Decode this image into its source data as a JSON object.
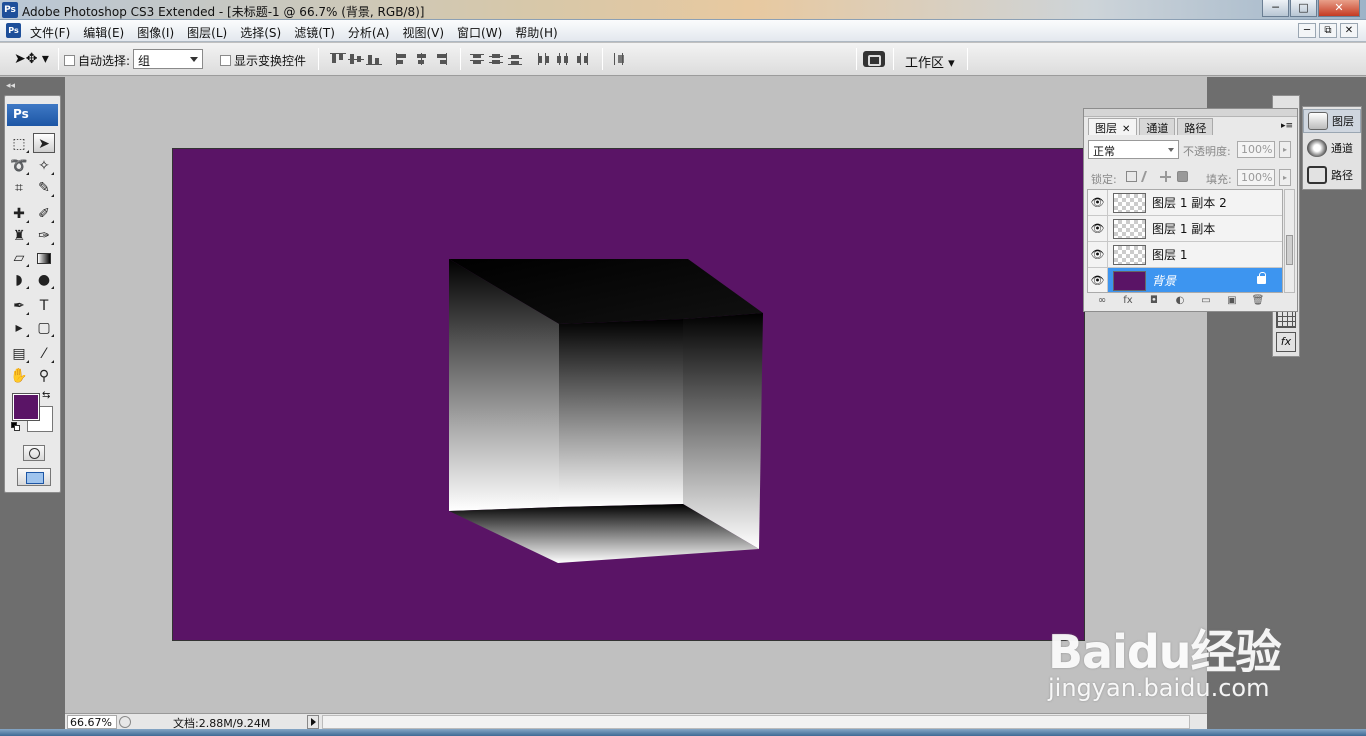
{
  "app": {
    "title": "Adobe Photoshop CS3 Extended - [未标题-1 @ 66.7% (背景, RGB/8)]",
    "logo": "Ps"
  },
  "window_controls": [
    "─",
    "□",
    "✕"
  ],
  "doc_controls": [
    "─",
    "⧉",
    "✕"
  ],
  "menu": [
    "文件(F)",
    "编辑(E)",
    "图像(I)",
    "图层(L)",
    "选择(S)",
    "滤镜(T)",
    "分析(A)",
    "视图(V)",
    "窗口(W)",
    "帮助(H)"
  ],
  "options": {
    "auto_select_label": "自动选择:",
    "auto_select_value": "组",
    "show_transform_label": "显示变换控件",
    "workspace_label": "工作区 ▾"
  },
  "toolbox": {
    "header": "Ps",
    "foreground_color": "#5a1466",
    "background_color": "#ffffff"
  },
  "document": {
    "background_color": "#5a1466",
    "zoom": "66.67%",
    "doc_info": "文档:2.88M/9.24M"
  },
  "layers_panel": {
    "tabs": [
      "图层",
      "通道",
      "路径"
    ],
    "blend_mode": "正常",
    "opacity_label": "不透明度:",
    "opacity_value": "100%",
    "lock_label": "锁定:",
    "fill_label": "填充:",
    "fill_value": "100%",
    "layers": [
      {
        "name": "图层 1 副本 2",
        "selected": false
      },
      {
        "name": "图层 1 副本",
        "selected": false
      },
      {
        "name": "图层 1",
        "selected": false
      },
      {
        "name": "背景",
        "selected": true
      }
    ]
  },
  "dock": [
    "图层",
    "通道",
    "路径"
  ],
  "watermark": {
    "brand": "Bai",
    "brand_tail": "经验",
    "url": "jingyan.baidu.com"
  }
}
